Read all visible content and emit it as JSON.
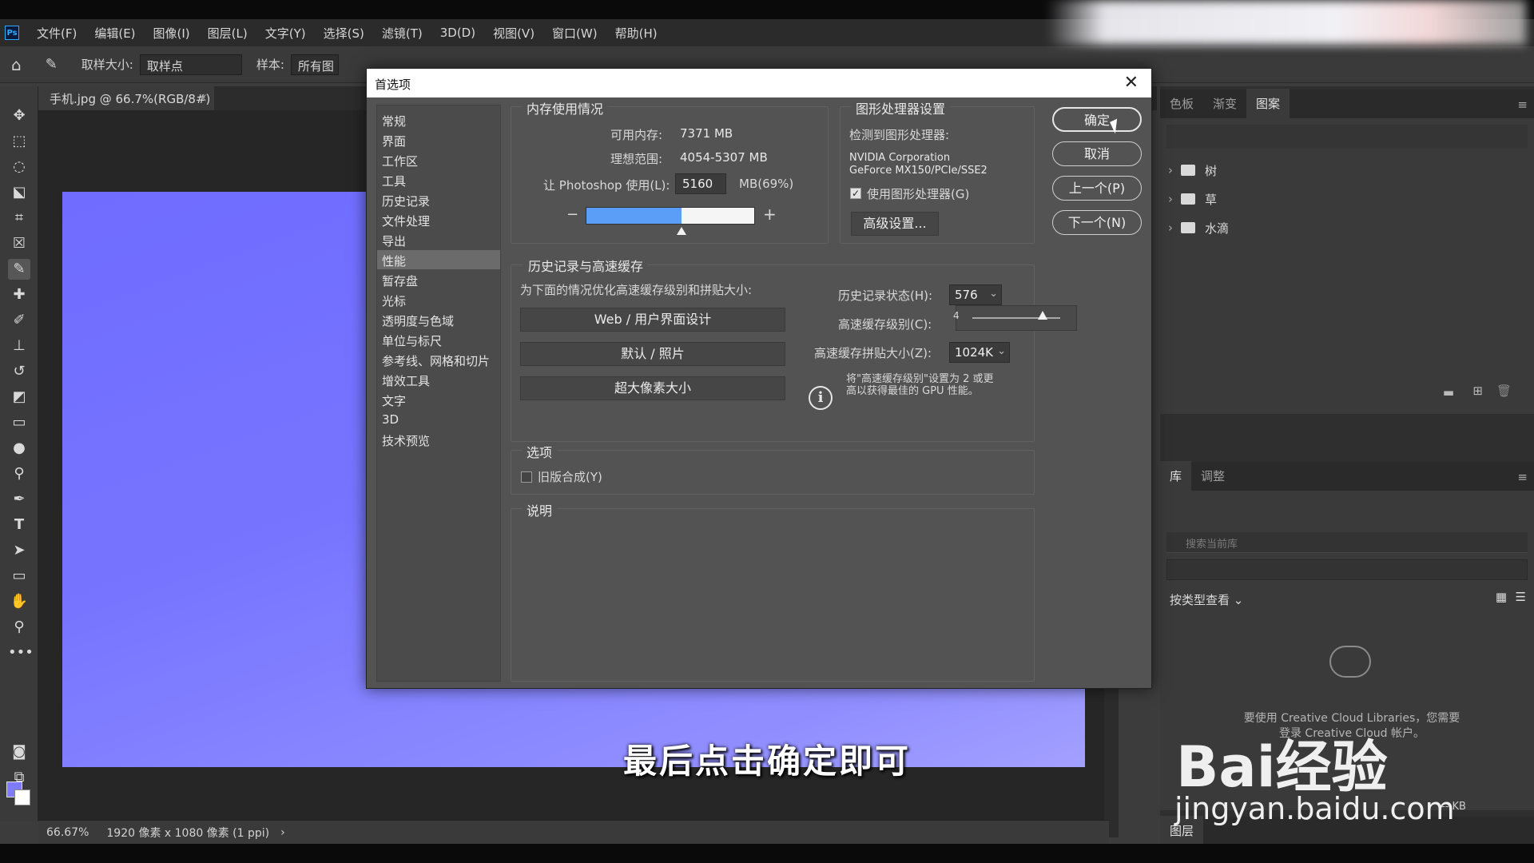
{
  "menubar": {
    "logo": "Ps",
    "items": [
      "文件(F)",
      "编辑(E)",
      "图像(I)",
      "图层(L)",
      "文字(Y)",
      "选择(S)",
      "滤镜(T)",
      "3D(D)",
      "视图(V)",
      "窗口(W)",
      "帮助(H)"
    ]
  },
  "optionsbar": {
    "sample_size_label": "取样大小:",
    "sample_size_value": "取样点",
    "sample_label": "样本:",
    "sample_value": "所有图"
  },
  "document_tab": {
    "label": "手机.jpg @ 66.7%(RGB/8#)",
    "close": "×"
  },
  "statusbar": {
    "zoom": "66.67%",
    "info": "1920 像素 x 1080 像素 (1 ppi)",
    "arrow": "›"
  },
  "dialog": {
    "title": "首选项",
    "close": "✕",
    "categories": [
      "常规",
      "界面",
      "工作区",
      "工具",
      "历史记录",
      "文件处理",
      "导出",
      "性能",
      "暂存盘",
      "光标",
      "透明度与色域",
      "单位与标尺",
      "参考线、网格和切片",
      "增效工具",
      "文字",
      "3D",
      "技术预览"
    ],
    "selected_category": "性能",
    "memory": {
      "title": "内存使用情况",
      "available_label": "可用内存:",
      "available_value": "7371 MB",
      "ideal_label": "理想范围:",
      "ideal_value": "4054-5307 MB",
      "use_label": "让 Photoshop 使用(L):",
      "use_value": "5160",
      "use_unit": "MB(69%)",
      "minus": "−",
      "plus": "+",
      "percent": 69
    },
    "gpu": {
      "title": "图形处理器设置",
      "detected_label": "检测到图形处理器:",
      "vendor": "NVIDIA Corporation",
      "model": "GeForce MX150/PCIe/SSE2",
      "use_gpu_label": "使用图形处理器(G)",
      "use_gpu_checked": true,
      "advanced_button": "高级设置..."
    },
    "history": {
      "title": "历史记录与高速缓存",
      "optimize_label": "为下面的情况优化高速缓存级别和拼贴大小:",
      "preset_buttons": [
        "Web / 用户界面设计",
        "默认 / 照片",
        "超大像素大小"
      ],
      "states_label": "历史记录状态(H):",
      "states_value": "576",
      "cache_levels_label": "高速缓存级别(C):",
      "cache_levels_value": "4",
      "cache_level_fraction": 0.8,
      "tile_size_label": "高速缓存拼贴大小(Z):",
      "tile_size_value": "1024K",
      "info_text_1": "将\"高速缓存级别\"设置为 2 或更",
      "info_text_2": "高以获得最佳的 GPU 性能。"
    },
    "options": {
      "title": "选项",
      "legacy_label": "旧版合成(Y)",
      "legacy_checked": false
    },
    "description": {
      "title": "说明"
    },
    "buttons": {
      "ok": "确定",
      "cancel": "取消",
      "prev": "上一个(P)",
      "next": "下一个(N)"
    }
  },
  "right_panel": {
    "top_tabs": [
      "色板",
      "渐变",
      "图案"
    ],
    "active_top_tab": "图案",
    "folders": [
      "树",
      "草",
      "水滴"
    ],
    "lib_tabs": [
      "库",
      "调整"
    ],
    "lib_search_placeholder": "搜索当前库",
    "lib_view_label": "按类型查看 ⌄",
    "lib_message_1": "要使用 Creative Cloud Libraries，您需要",
    "lib_message_2": "登录 Creative Cloud 帐户。",
    "lib_size": "-- KB",
    "bottom_tab": "图层"
  },
  "overlay": {
    "subtitle": "最后点击确定即可",
    "watermark_brand": "Bai经验",
    "watermark_url": "jingyan.baidu.com"
  },
  "colors": {
    "canvas": "#6f6cff",
    "accent_bar": "#5b9ef8",
    "foreground": "#7e7bff"
  }
}
